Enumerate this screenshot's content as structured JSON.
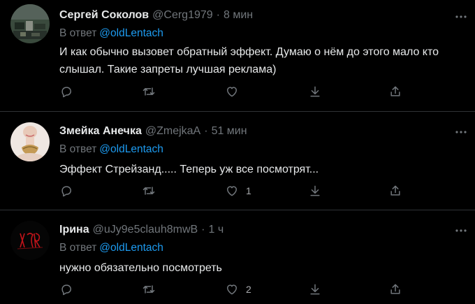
{
  "tweets": [
    {
      "name": "Сергей Соколов",
      "handle": "@Cerg1979",
      "dot": "·",
      "time": "8 мин",
      "reply_prefix": "В ответ",
      "reply_to": "@oldLentach",
      "text": "И как обычно вызовет обратный эффект. Думаю о нём до этого мало кто слышал. Такие запреты лучшая реклама)",
      "like_count": ""
    },
    {
      "name": "Змейка Анечка",
      "handle": "@ZmejkaA",
      "dot": "·",
      "time": "51 мин",
      "reply_prefix": "В ответ",
      "reply_to": "@oldLentach",
      "text": "Эффект Стрейзанд..... Теперь уж все посмотрят...",
      "like_count": "1"
    },
    {
      "name": "Ірина",
      "handle": "@uJy9e5clauh8mwB",
      "dot": "·",
      "time": "1 ч",
      "reply_prefix": "В ответ",
      "reply_to": "@oldLentach",
      "text": "нужно обязательно посмотреть",
      "like_count": "2"
    }
  ],
  "icons": {
    "more": "more-horizontal-icon",
    "reply": "reply-bubble-icon",
    "retweet": "retweet-icon",
    "like": "heart-icon",
    "download": "download-arrow-icon",
    "share": "share-icon"
  },
  "colors": {
    "background": "#000000",
    "link": "#1d9bf0",
    "muted": "#71767b",
    "text": "#e7e9ea",
    "divider": "#2f3336"
  }
}
